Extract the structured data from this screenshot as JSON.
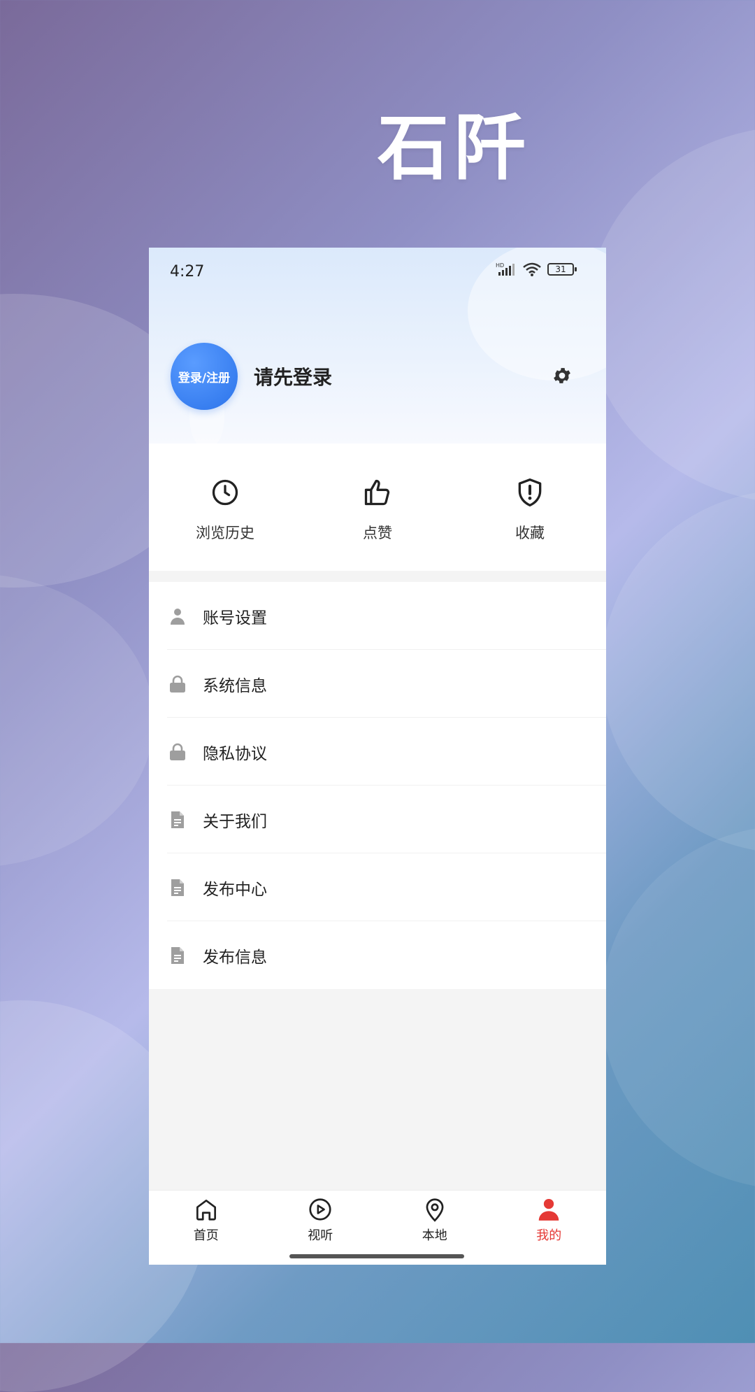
{
  "brand": "石阡",
  "status": {
    "time": "4:27",
    "network": "HD",
    "battery": "31"
  },
  "profile": {
    "avatar_label": "登录/注册",
    "login_prompt": "请先登录"
  },
  "quick_actions": [
    {
      "label": "浏览历史",
      "icon": "clock-icon"
    },
    {
      "label": "点赞",
      "icon": "thumbs-up-icon"
    },
    {
      "label": "收藏",
      "icon": "shield-alert-icon"
    }
  ],
  "menu": [
    {
      "label": "账号设置",
      "icon": "user-icon"
    },
    {
      "label": "系统信息",
      "icon": "lock-icon"
    },
    {
      "label": "隐私协议",
      "icon": "lock-icon"
    },
    {
      "label": "关于我们",
      "icon": "document-icon"
    },
    {
      "label": "发布中心",
      "icon": "document-icon"
    },
    {
      "label": "发布信息",
      "icon": "document-icon"
    }
  ],
  "tabs": [
    {
      "label": "首页",
      "icon": "home-icon",
      "active": false
    },
    {
      "label": "视听",
      "icon": "play-icon",
      "active": false
    },
    {
      "label": "本地",
      "icon": "location-pin-icon",
      "active": false
    },
    {
      "label": "我的",
      "icon": "person-icon",
      "active": true
    }
  ],
  "colors": {
    "accent": "#e53935",
    "avatar_blue": "#2b73ea",
    "menu_icon": "#9e9e9e"
  }
}
